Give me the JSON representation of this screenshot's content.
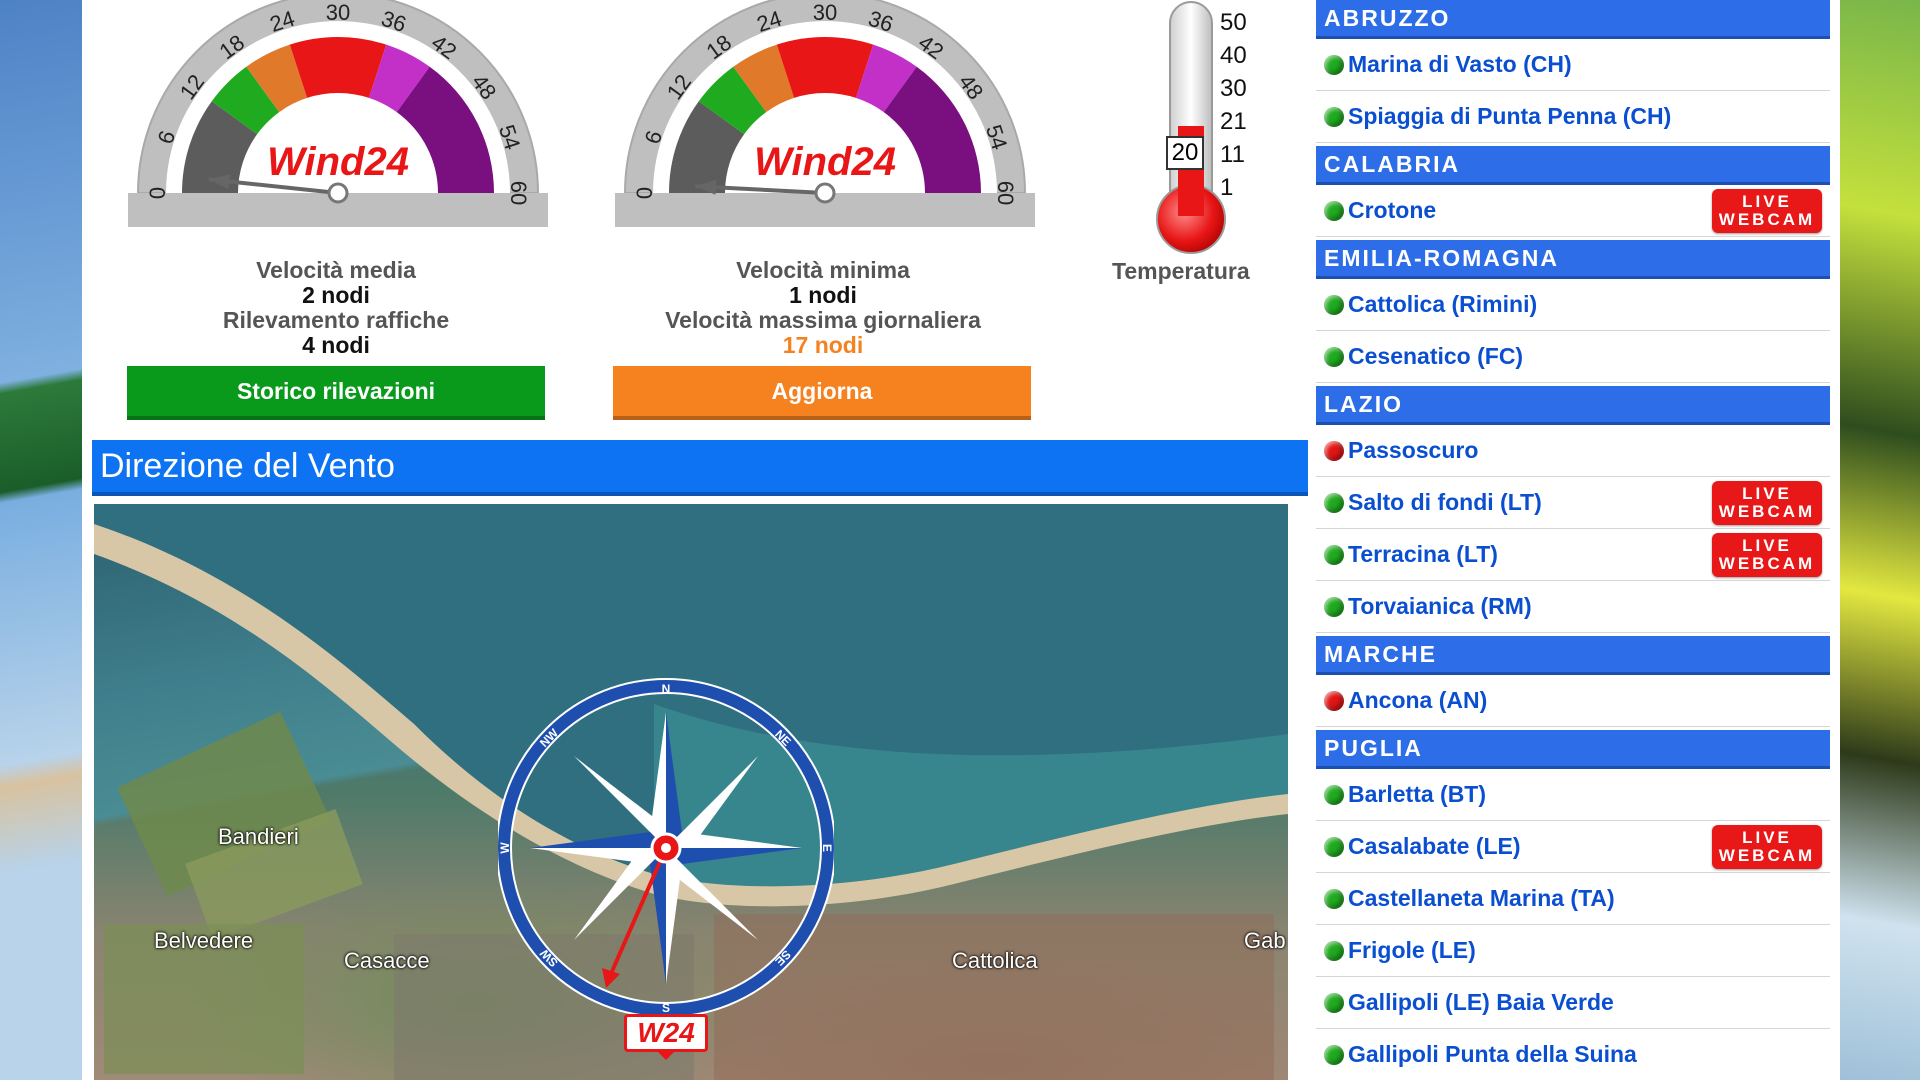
{
  "gauge_labels": [
    "0",
    "6",
    "12",
    "18",
    "24",
    "30",
    "36",
    "42",
    "48",
    "54",
    "60"
  ],
  "gauge_logo": "Wind24",
  "gauge1": {
    "value_knots": 2,
    "label1": "Velocità media",
    "value1": "2  nodi",
    "label2": "Rilevamento raffiche",
    "value2": "4 nodi",
    "button": "Storico rilevazioni"
  },
  "gauge2": {
    "value_knots": 1,
    "label1": "Velocità minima",
    "value1": "1 nodi",
    "label2": "Velocità massima giornaliera",
    "value2": "17 nodi",
    "button": "Aggiorna"
  },
  "thermometer": {
    "scale": [
      "50",
      "40",
      "30",
      "21",
      "11",
      "1"
    ],
    "current": "20",
    "label": "Temperatura"
  },
  "direction": {
    "title": "Direzione del Vento",
    "compass_points": {
      "n": "N",
      "ne": "NE",
      "e": "E",
      "se": "SE",
      "s": "S",
      "sw": "SW",
      "w": "W",
      "nw": "NW"
    },
    "badge": "W24",
    "map_labels": {
      "bandieri": "Bandieri",
      "belvedere": "Belvedere",
      "casacce": "Casacce",
      "cattolica": "Cattolica",
      "gab": "Gab"
    }
  },
  "live_text": [
    "LIVE",
    "WEBCAM"
  ],
  "sidebar": [
    {
      "region": "ABRUZZO",
      "locations": [
        {
          "name": "Marina di Vasto (CH)",
          "status": "green",
          "live": false
        },
        {
          "name": "Spiaggia di Punta Penna (CH)",
          "status": "green",
          "live": false
        }
      ]
    },
    {
      "region": "CALABRIA",
      "locations": [
        {
          "name": "Crotone",
          "status": "green",
          "live": true
        }
      ]
    },
    {
      "region": "EMILIA-ROMAGNA",
      "locations": [
        {
          "name": "Cattolica (Rimini)",
          "status": "green",
          "live": false
        },
        {
          "name": "Cesenatico (FC)",
          "status": "green",
          "live": false
        }
      ]
    },
    {
      "region": "LAZIO",
      "locations": [
        {
          "name": "Passoscuro",
          "status": "red",
          "live": false
        },
        {
          "name": "Salto di fondi (LT)",
          "status": "green",
          "live": true
        },
        {
          "name": "Terracina (LT)",
          "status": "green",
          "live": true
        },
        {
          "name": "Torvaianica (RM)",
          "status": "green",
          "live": false
        }
      ]
    },
    {
      "region": "MARCHE",
      "locations": [
        {
          "name": "Ancona (AN)",
          "status": "red",
          "live": false
        }
      ]
    },
    {
      "region": "PUGLIA",
      "locations": [
        {
          "name": "Barletta (BT)",
          "status": "green",
          "live": false
        },
        {
          "name": "Casalabate (LE)",
          "status": "green",
          "live": true
        },
        {
          "name": "Castellaneta Marina (TA)",
          "status": "green",
          "live": false
        },
        {
          "name": "Frigole (LE)",
          "status": "green",
          "live": false
        },
        {
          "name": "Gallipoli (LE) Baia Verde",
          "status": "green",
          "live": false
        },
        {
          "name": "Gallipoli Punta della Suina",
          "status": "green",
          "live": false
        }
      ]
    }
  ]
}
